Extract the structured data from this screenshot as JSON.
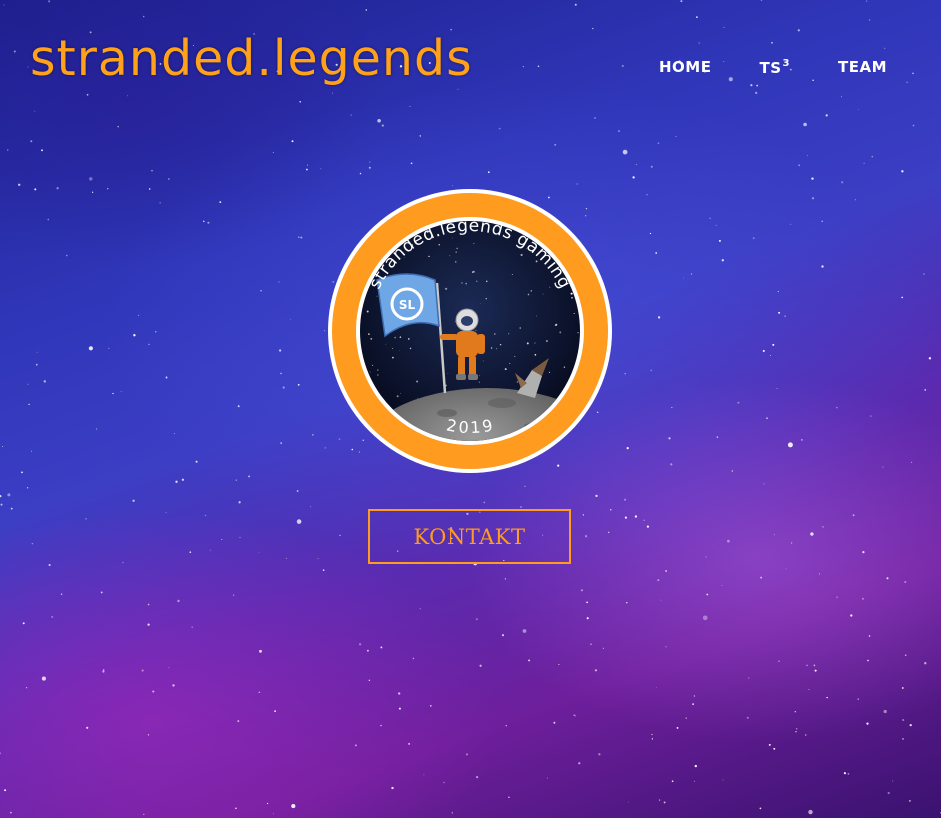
{
  "site": {
    "title": "stranded.legends"
  },
  "nav": {
    "items": [
      {
        "label": "HOME"
      },
      {
        "label": "TS",
        "sup": "3"
      },
      {
        "label": "TEAM"
      }
    ]
  },
  "badge": {
    "ring_text": "stranded.legends gaming",
    "year": "2019",
    "flag_text": "SL"
  },
  "cta": {
    "label": "KONTAKT"
  },
  "colors": {
    "accent": "#ff9b1f",
    "nav_text": "#ffffff"
  }
}
